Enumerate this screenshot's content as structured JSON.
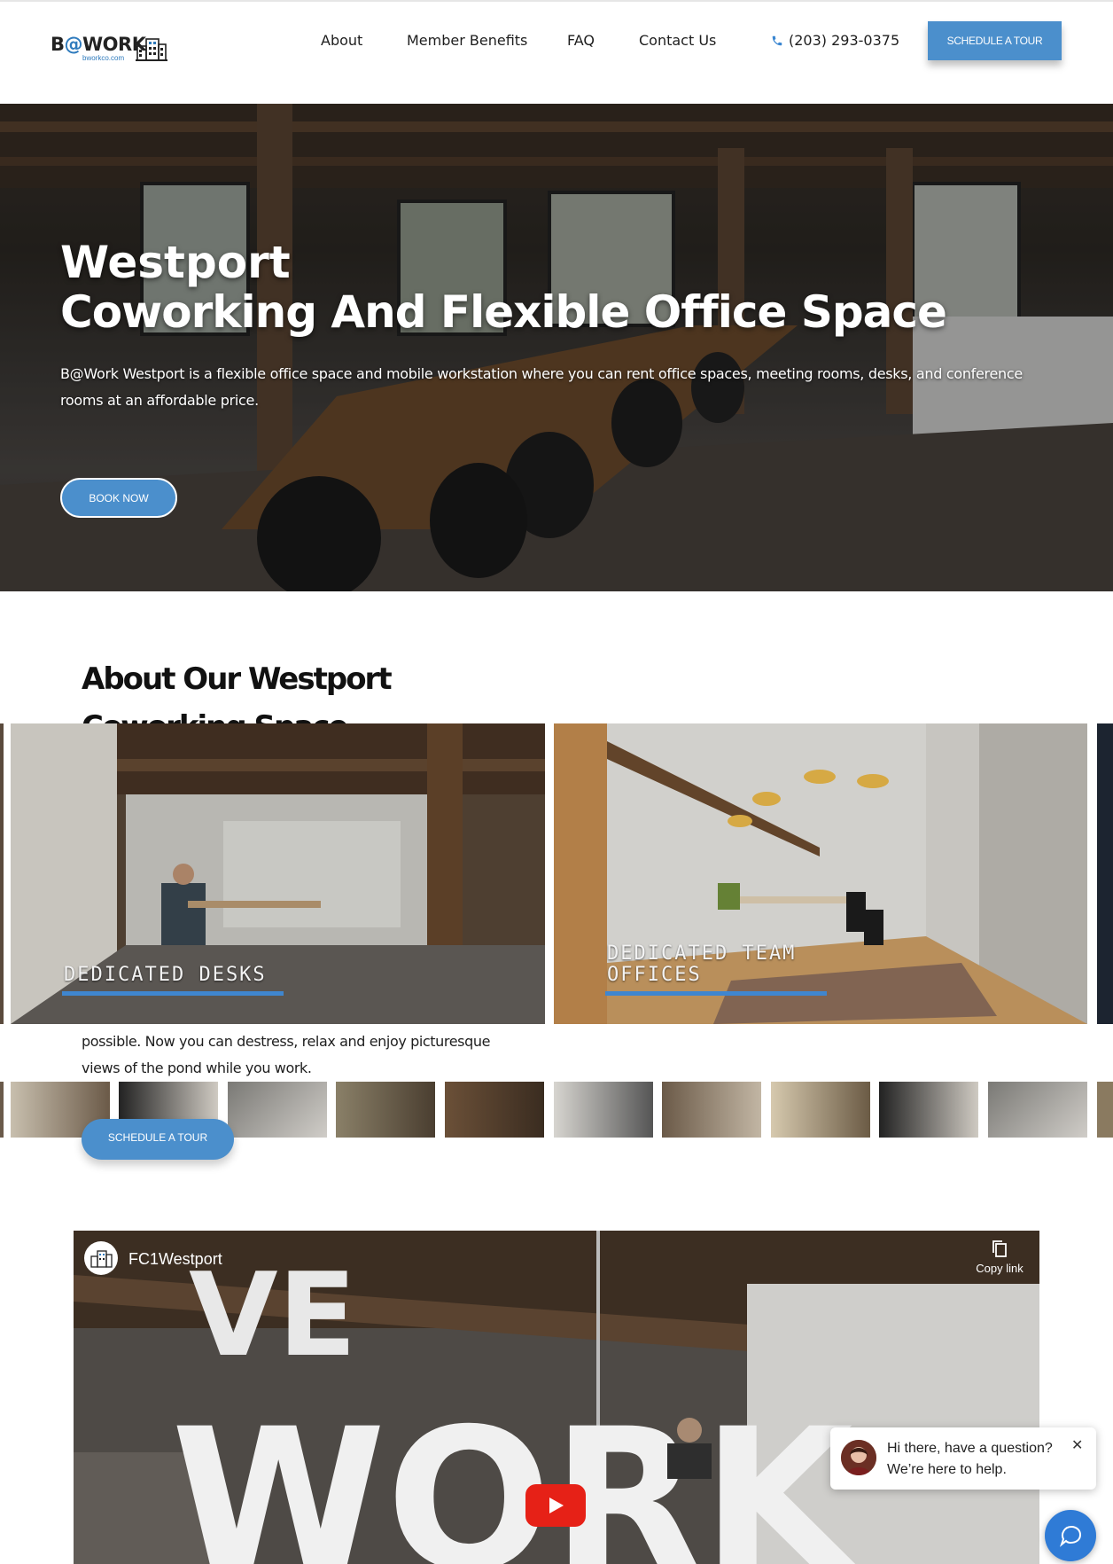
{
  "header": {
    "logo_text": "B@WORK",
    "logo_sub": "bworkco.com",
    "nav": [
      "About",
      "Member Benefits",
      "FAQ",
      "Contact Us"
    ],
    "phone": "(203) 293-0375",
    "tour_label": "SCHEDULE A TOUR"
  },
  "hero": {
    "title_line1": "Westport",
    "title_line2": "Coworking And Flexible Office Space",
    "description": "B@Work Westport is a flexible office space and mobile workstation where you can rent office spaces, meeting rooms, desks, and conference rooms at an affordable price.",
    "book_label": "BOOK NOW"
  },
  "about": {
    "title_line1": "About Our Westport",
    "title_line2": "Coworking Space",
    "text": "possible. Now you can destress, relax and enjoy picturesque views of the pond while you work.",
    "tour_label": "SCHEDULE A TOUR"
  },
  "slider": {
    "slides": [
      {
        "caption": "DEDICATED DESKS"
      },
      {
        "caption": "DEDICATED TEAM OFFICES"
      }
    ],
    "thumb_count": 10
  },
  "video": {
    "channel": "FC1Westport",
    "copy_label": "Copy link"
  },
  "chat": {
    "line1": "Hi there, have a question?",
    "line2": "We’re here to help."
  },
  "colors": {
    "accent": "#4b8fcc",
    "slide_bar": "#3f86cf",
    "play_red": "#e62117",
    "chat_blue": "#2f7bd6"
  }
}
